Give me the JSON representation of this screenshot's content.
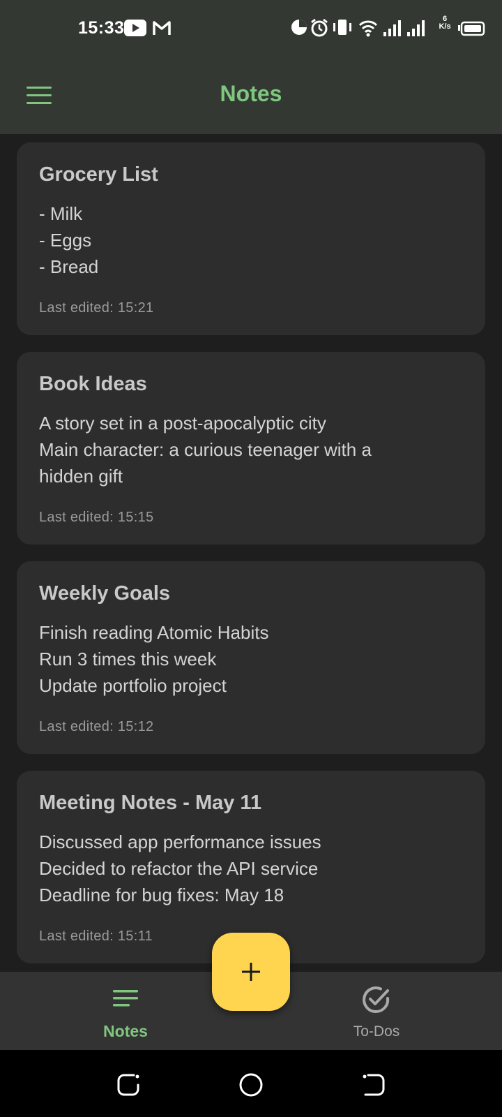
{
  "status_bar": {
    "time": "15:33",
    "net_speed_value": "6",
    "net_speed_unit": "K/s",
    "icons": [
      "youtube-icon",
      "gmail-icon",
      "data-saver-icon",
      "alarm-icon",
      "vibrate-icon",
      "wifi-icon",
      "signal-icon",
      "signal-icon",
      "battery-icon"
    ]
  },
  "app_bar": {
    "title": "Notes",
    "menu_icon": "hamburger-menu-icon"
  },
  "notes": [
    {
      "title": "Grocery List",
      "body": "- Milk\n- Eggs\n- Bread",
      "edited": "Last edited: 15:21"
    },
    {
      "title": "Book Ideas",
      "body": "A story set in a post-apocalyptic city\nMain character: a curious teenager with a\nhidden gift",
      "edited": "Last edited: 15:15"
    },
    {
      "title": "Weekly Goals",
      "body": "Finish reading Atomic Habits\nRun 3 times this week\nUpdate portfolio project",
      "edited": "Last edited: 15:12"
    },
    {
      "title": "Meeting Notes - May 11",
      "body": "Discussed app performance issues\nDecided to refactor the API service\nDeadline for bug fixes: May 18",
      "edited": "Last edited: 15:11"
    }
  ],
  "fab": {
    "icon": "plus-icon"
  },
  "bottom_nav": {
    "items": [
      {
        "label": "Notes",
        "icon": "notes-lines-icon",
        "selected": true
      },
      {
        "label": "To-Dos",
        "icon": "check-circle-icon",
        "selected": false
      }
    ]
  },
  "colors": {
    "accent": "#7fc77f",
    "fab": "#ffd54f",
    "card": "#2d2d2d",
    "background": "#1e1e1e",
    "app_bar": "#343833"
  }
}
